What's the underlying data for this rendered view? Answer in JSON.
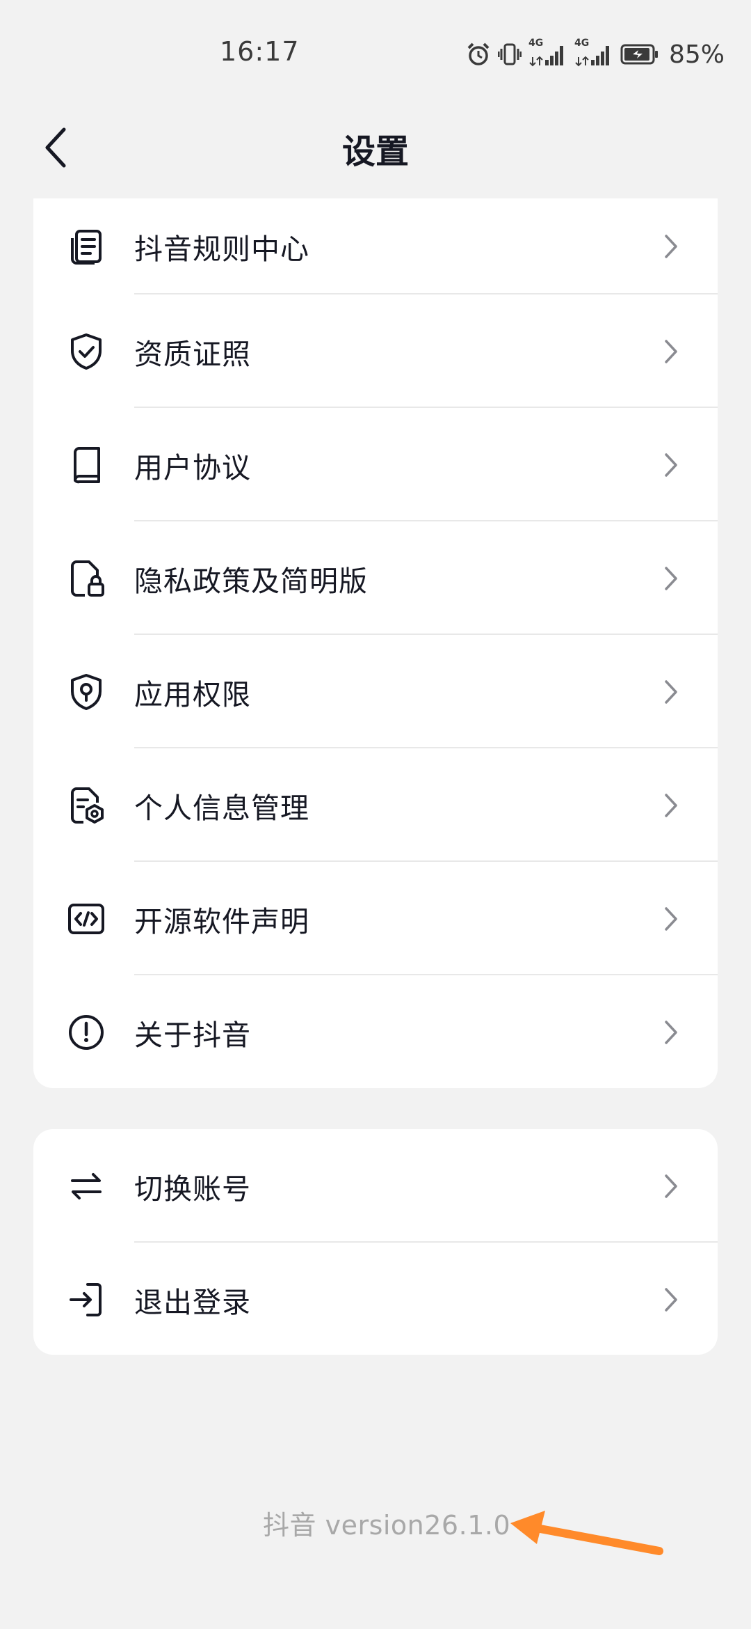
{
  "status_bar": {
    "time": "16:17",
    "network_1": "4G",
    "network_2": "4G",
    "battery_percent": "85%"
  },
  "header": {
    "title": "设置"
  },
  "about_section": {
    "items": [
      {
        "label": "抖音规则中心",
        "icon": "rules-document-icon"
      },
      {
        "label": "资质证照",
        "icon": "shield-check-icon"
      },
      {
        "label": "用户协议",
        "icon": "book-icon"
      },
      {
        "label": "隐私政策及简明版",
        "icon": "privacy-lock-icon"
      },
      {
        "label": "应用权限",
        "icon": "permission-shield-icon"
      },
      {
        "label": "个人信息管理",
        "icon": "personal-info-icon"
      },
      {
        "label": "开源软件声明",
        "icon": "code-icon"
      },
      {
        "label": "关于抖音",
        "icon": "info-exclamation-icon"
      }
    ]
  },
  "account_section": {
    "items": [
      {
        "label": "切换账号",
        "icon": "switch-arrows-icon"
      },
      {
        "label": "退出登录",
        "icon": "logout-icon"
      }
    ]
  },
  "footer": {
    "version_text": "抖音 version26.1.0"
  },
  "colors": {
    "background": "#f2f2f2",
    "card": "#ffffff",
    "text_primary": "#161823",
    "text_secondary": "#a8a8a8",
    "annotation_arrow": "#ff8a2a"
  }
}
